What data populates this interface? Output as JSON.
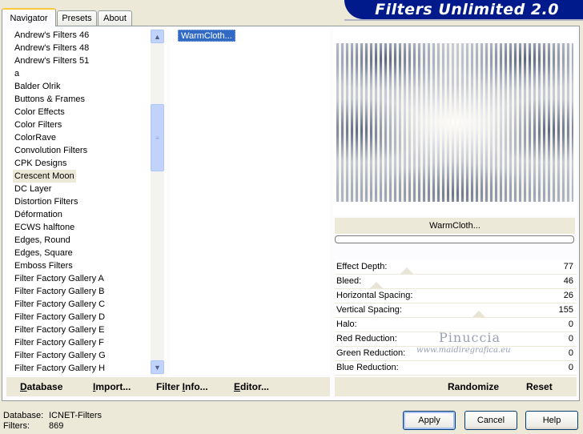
{
  "window": {
    "banner_title": "Filters Unlimited 2.0"
  },
  "tabs": [
    {
      "label": "Navigator",
      "active": true
    },
    {
      "label": "Presets",
      "active": false
    },
    {
      "label": "About",
      "active": false
    }
  ],
  "categories": {
    "selected": "Crescent Moon",
    "items": [
      "Andrew's Filters 46",
      "Andrew's Filters 48",
      "Andrew's Filters 51",
      "a",
      "Balder Olrik",
      "Buttons & Frames",
      "Color Effects",
      "Color Filters",
      "ColorRave",
      "Convolution Filters",
      "CPK Designs",
      "Crescent Moon",
      "DC Layer",
      "Distortion Filters",
      "Déformation",
      "ECWS halftone",
      "Edges, Round",
      "Edges, Square",
      "Emboss Filters",
      "Filter Factory Gallery A",
      "Filter Factory Gallery B",
      "Filter Factory Gallery C",
      "Filter Factory Gallery D",
      "Filter Factory Gallery E",
      "Filter Factory Gallery F",
      "Filter Factory Gallery G",
      "Filter Factory Gallery H"
    ],
    "scroll_up_icon": "arrow-up-icon",
    "scroll_down_icon": "arrow-down-icon"
  },
  "filters": {
    "items": [
      "WarmCloth..."
    ],
    "selected": "WarmCloth..."
  },
  "preview": {
    "filter_name": "WarmCloth...",
    "progress": 0
  },
  "params": [
    {
      "label": "Effect Depth:",
      "value": "77"
    },
    {
      "label": "Bleed:",
      "value": "46"
    },
    {
      "label": "Horizontal Spacing:",
      "value": "26"
    },
    {
      "label": "Vertical Spacing:",
      "value": "155"
    },
    {
      "label": "Halo:",
      "value": "0"
    },
    {
      "label": "Red Reduction:",
      "value": "0"
    },
    {
      "label": "Green Reduction:",
      "value": "0"
    },
    {
      "label": "Blue Reduction:",
      "value": "0"
    }
  ],
  "watermark": {
    "name": "Pinuccia",
    "url": "www.maidiregrafica.eu"
  },
  "toolbar": {
    "database": {
      "first": "D",
      "rest": "atabase"
    },
    "import": {
      "first": "I",
      "rest": "mport..."
    },
    "filter_info": {
      "first": "Filter ",
      "u": "I",
      "rest": "nfo..."
    },
    "editor": {
      "first": "E",
      "rest": "ditor..."
    },
    "randomize": "Randomize",
    "reset": "Reset"
  },
  "status": {
    "database_label": "Database:",
    "database_value": "ICNET-Filters",
    "filters_label": "Filters:",
    "filters_value": "869"
  },
  "buttons": {
    "apply": "Apply",
    "cancel": "Cancel",
    "help": "Help"
  }
}
